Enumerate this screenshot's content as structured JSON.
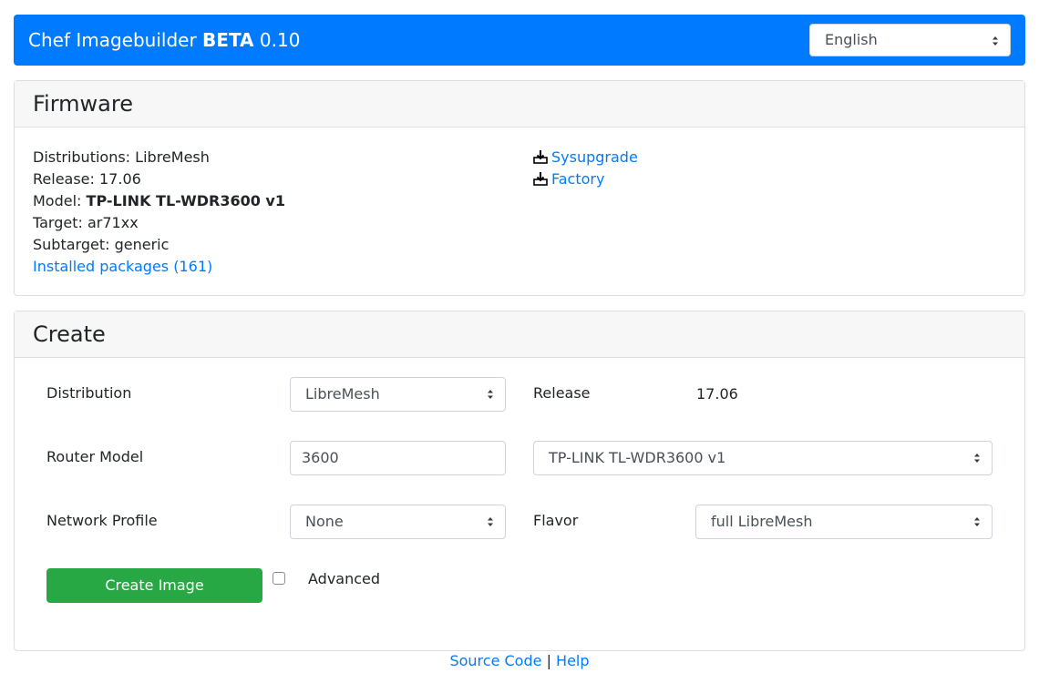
{
  "navbar": {
    "brand_name": "Chef Imagebuilder",
    "brand_beta": "BETA",
    "brand_version": "0.10",
    "language_selected": "English"
  },
  "firmware": {
    "title": "Firmware",
    "distribution_label": "Distributions:",
    "distribution_value": "LibreMesh",
    "release_label": "Release:",
    "release_value": "17.06",
    "model_label": "Model:",
    "model_value": "TP-LINK TL-WDR3600 v1",
    "target_label": "Target:",
    "target_value": "ar71xx",
    "subtarget_label": "Subtarget:",
    "subtarget_value": "generic",
    "installed_packages_link": "Installed packages (161)",
    "downloads": [
      {
        "label": "Sysupgrade",
        "icon": "download-icon"
      },
      {
        "label": "Factory",
        "icon": "download-icon"
      }
    ]
  },
  "create": {
    "title": "Create",
    "distribution_label": "Distribution",
    "distribution_selected": "LibreMesh",
    "release_label": "Release",
    "release_value": "17.06",
    "router_model_label": "Router Model",
    "router_model_input_value": "3600",
    "router_model_selected": "TP-LINK TL-WDR3600 v1",
    "network_profile_label": "Network Profile",
    "network_profile_selected": "None",
    "flavor_label": "Flavor",
    "flavor_selected": "full LibreMesh",
    "create_button_label": "Create Image",
    "advanced_label": "Advanced",
    "advanced_checked": false
  },
  "footer": {
    "source_code_link": "Source Code",
    "separator": "|",
    "help_link": "Help"
  },
  "colors": {
    "primary": "#007bff",
    "success": "#28a745",
    "card_header_bg": "#f7f7f7"
  }
}
